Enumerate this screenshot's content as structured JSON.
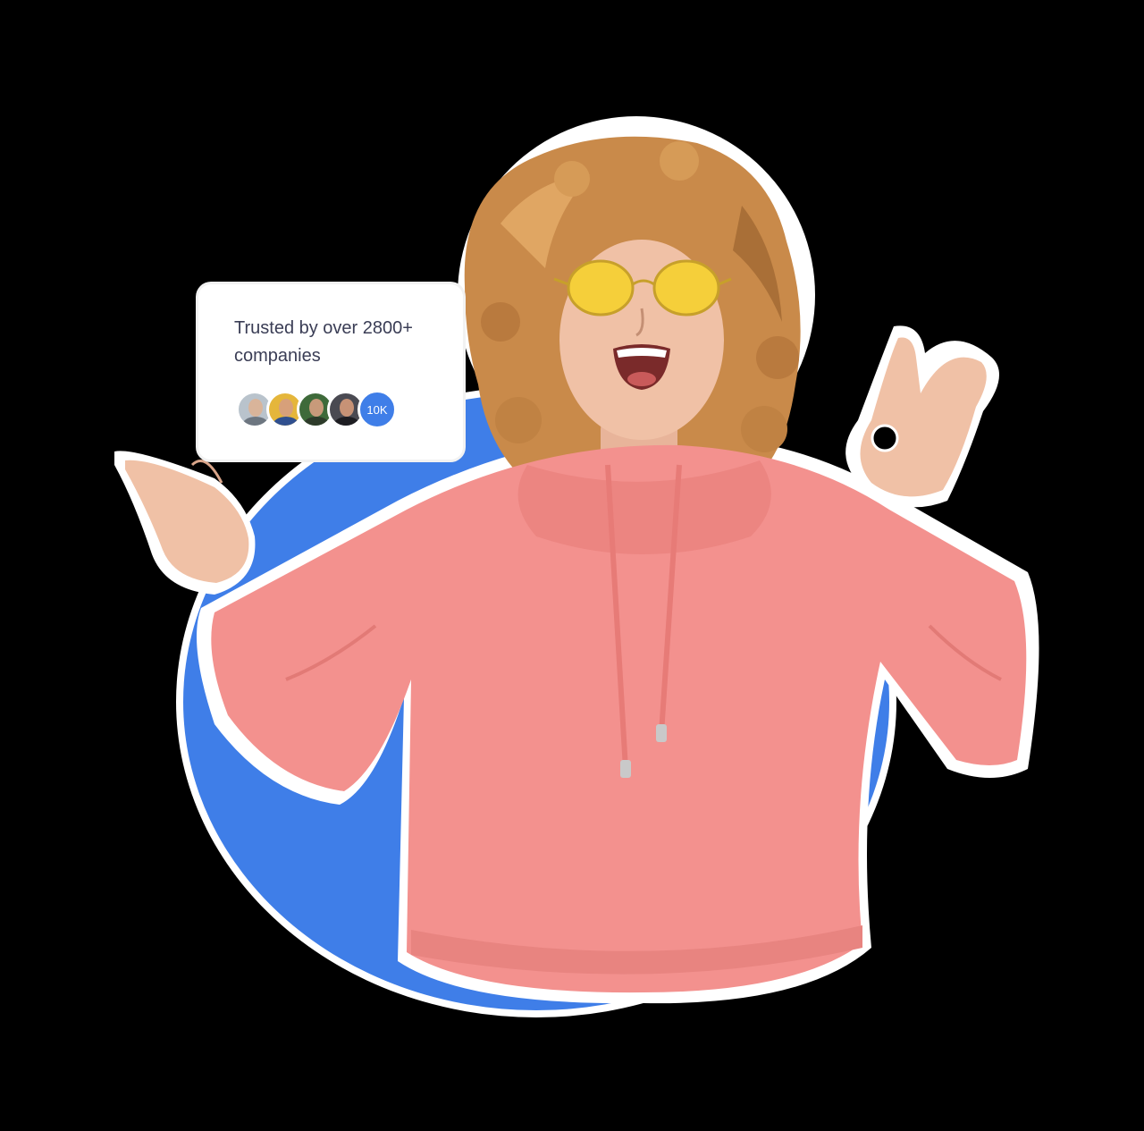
{
  "card": {
    "trust_text": "Trusted by over 2800+ companies",
    "avatars": [
      {
        "name": "avatar-1",
        "bg": "#b9c3cc",
        "skin": "#d9b49a",
        "shirt": "#6d7680"
      },
      {
        "name": "avatar-2",
        "bg": "#e5b63b",
        "skin": "#d7a07a",
        "shirt": "#2f4f8f"
      },
      {
        "name": "avatar-3",
        "bg": "#3e6a3a",
        "skin": "#c89a7a",
        "shirt": "#2d3b2a"
      },
      {
        "name": "avatar-4",
        "bg": "#4a4a52",
        "skin": "#c79276",
        "shirt": "#1d1d22"
      }
    ],
    "count_badge": "10K"
  },
  "colors": {
    "background": "#000000",
    "accent_blue": "#3f7ee8",
    "hoodie_pink": "#f3918e",
    "hair": "#c98a4a",
    "glasses": "#f5cf3a"
  }
}
